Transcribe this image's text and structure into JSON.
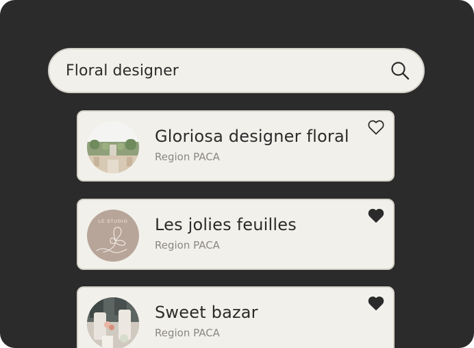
{
  "search": {
    "value": "Floral designer",
    "icon": "search-icon"
  },
  "results": [
    {
      "name": "Gloriosa designer floral",
      "region": "Region PACA",
      "favorite": false,
      "avatar": "garden-ceremony-photo"
    },
    {
      "name": "Les jolies feuilles",
      "region": "Region PACA",
      "favorite": true,
      "avatar": "le-studio-logo",
      "avatar_text": "LE STUDIO"
    },
    {
      "name": "Sweet bazar",
      "region": "Region PACA",
      "favorite": true,
      "avatar": "wedding-table-photo"
    }
  ],
  "colors": {
    "background": "#2b2b2b",
    "card": "#f2f0ea",
    "card_border": "#d4d1c9",
    "text": "#2b2b2b",
    "muted_text": "#8a8782",
    "logo_bg": "#b8a59a"
  }
}
